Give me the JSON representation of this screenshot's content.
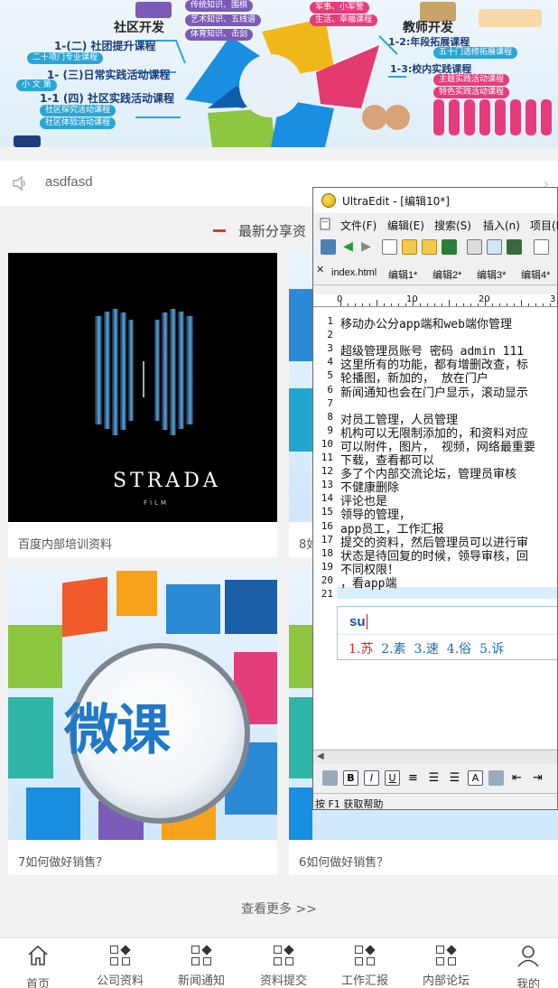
{
  "banner": {
    "texts": [
      "社区开发",
      "教师开发",
      "1-(二) 社团提升课程",
      "二十项门专业课程",
      "1- (三)日常实践活动课程",
      "小 文 第",
      "1-1 (四) 社区实践活动课程",
      "社区探究活动课程",
      "社区体验活动课程",
      "1-2:年段拓展课程",
      "1-3:校内实践课程",
      "五十门选修拓展课程",
      "主题实践活动课程",
      "特色实践活动课程",
      "传统知识、围棋",
      "艺术知识、五线谱",
      "体育知识、击剑",
      "军事、小军警",
      "生活、幸福课程"
    ]
  },
  "notice": {
    "text": "asdfasd"
  },
  "section": {
    "title": "最新分享资"
  },
  "cards": [
    {
      "caption": "百度内部培训资料",
      "brand": "STRADA",
      "brand_sub": "FILM"
    },
    {
      "caption": "8如"
    },
    {
      "caption": "7如何做好销售？",
      "big": "微课"
    },
    {
      "caption": "6如何做好销售？"
    }
  ],
  "view_more": "查看更多 >>",
  "tabs": [
    {
      "label": "首页",
      "icon": "home-icon"
    },
    {
      "label": "公司资料",
      "icon": "grid-icon"
    },
    {
      "label": "新闻通知",
      "icon": "grid-icon"
    },
    {
      "label": "资料提交",
      "icon": "grid-icon"
    },
    {
      "label": "工作汇报",
      "icon": "grid-icon"
    },
    {
      "label": "内部论坛",
      "icon": "grid-icon"
    },
    {
      "label": "我的",
      "icon": "user-icon"
    }
  ],
  "ultraedit": {
    "title": "UltraEdit - [编辑10*]",
    "menu": [
      "文件(F)",
      "编辑(E)",
      "搜索(S)",
      "插入(n)",
      "项目(P)"
    ],
    "tabs": [
      "index.html",
      "编辑1*",
      "编辑2*",
      "编辑3*",
      "编辑4*"
    ],
    "ruler": [
      "0",
      "10",
      "20",
      "3"
    ],
    "lines": [
      "移动办公分app端和web端你管理",
      "",
      "超级管理员账号 密码 admin 111",
      "这里所有的功能，都有增删改查，标",
      "轮播图，新加的， 放在门户",
      "新闻通知也会在门户显示，滚动显示",
      "",
      "对员工管理，人员管理",
      "机构可以无限制添加的，和资料对应",
      "可以附件，图片， 视频，网络最重要",
      "下载，查看都可以",
      "多了个内部交流论坛，管理员审核",
      "不健康删除",
      "评论也是",
      "领导的管理，",
      "app员工，工作汇报",
      "提交的资料，然后管理员可以进行审",
      "状态是待回复的时候，领导审核，回",
      "不同权限！",
      "，看app端",
      ""
    ],
    "ime": {
      "composition": "su",
      "candidates": [
        "1.苏",
        "2.素",
        "3.速",
        "4.俗",
        "5.诉"
      ]
    },
    "status": "按 F1 获取帮助"
  }
}
